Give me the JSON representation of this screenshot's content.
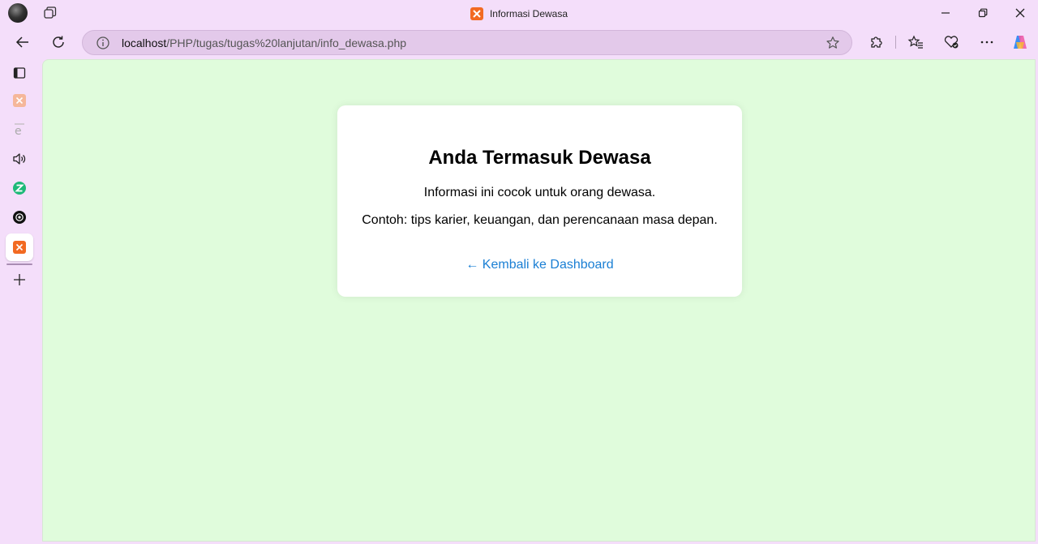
{
  "browser": {
    "tab_title": "Informasi Dewasa",
    "url_host": "localhost",
    "url_path": "/PHP/tugas/tugas%20lanjutan/info_dewasa.php",
    "icons": {
      "workspaces": "workspaces-icon",
      "back": "back-arrow-icon",
      "refresh": "refresh-icon",
      "info": "site-info-icon",
      "favorite": "star-icon",
      "extensions": "puzzle-icon",
      "favorites": "favorites-icon",
      "browser_essentials": "heart-pulse-icon",
      "more": "ellipsis-icon",
      "copilot": "copilot-icon",
      "minimize": "minimize-icon",
      "restore": "restore-icon",
      "close": "close-icon"
    }
  },
  "sidebar": {
    "items": [
      {
        "name": "tab-actions-icon"
      },
      {
        "name": "xampp-tab-icon"
      },
      {
        "name": "e-tab-icon"
      },
      {
        "name": "speaker-icon"
      },
      {
        "name": "z-app-icon"
      },
      {
        "name": "chatgpt-icon"
      },
      {
        "name": "xampp-active-tab-icon"
      },
      {
        "name": "add-icon"
      }
    ]
  },
  "page": {
    "heading": "Anda Termasuk Dewasa",
    "line1": "Informasi ini cocok untuk orang dewasa.",
    "line2": "Contoh: tips karier, keuangan, dan perencanaan masa depan.",
    "back_link": "← Kembali ke Dashboard"
  },
  "colors": {
    "page_bg": "#e0fcdc",
    "card_bg": "#ffffff",
    "link": "#1a7fd4",
    "frame": "#f4defa",
    "xampp": "#f26a22"
  }
}
